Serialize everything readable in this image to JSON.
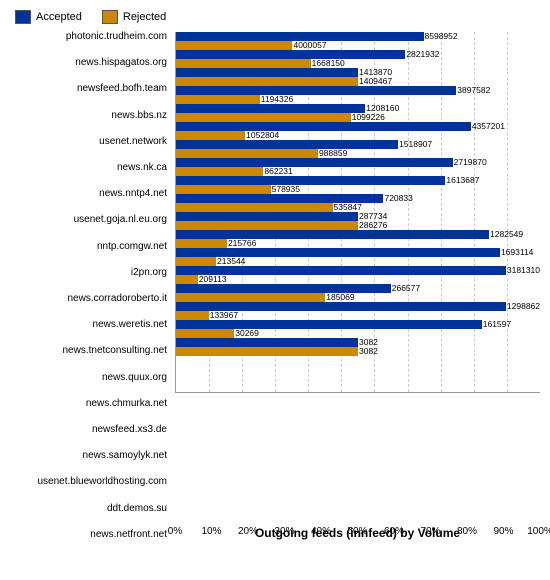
{
  "legend": {
    "accepted_label": "Accepted",
    "accepted_color": "#003399",
    "rejected_label": "Rejected",
    "rejected_color": "#cc8800"
  },
  "x_axis": {
    "ticks": [
      "0%",
      "10%",
      "20%",
      "30%",
      "40%",
      "50%",
      "60%",
      "70%",
      "80%",
      "90%",
      "100%"
    ],
    "title": "Outgoing feeds (innfeed) by Volume"
  },
  "rows": [
    {
      "label": "photonic.trudheim.com",
      "accepted": 8598952,
      "rejected": 4000057,
      "acc_pct": 68,
      "rej_pct": 32
    },
    {
      "label": "news.hispagatos.org",
      "accepted": 2821932,
      "rejected": 1668150,
      "acc_pct": 63,
      "rej_pct": 37
    },
    {
      "label": "newsfeed.bofh.team",
      "accepted": 1413870,
      "rejected": 1409467,
      "acc_pct": 50,
      "rej_pct": 50
    },
    {
      "label": "news.bbs.nz",
      "accepted": 3897582,
      "rejected": 1194326,
      "acc_pct": 77,
      "rej_pct": 23
    },
    {
      "label": "usenet.network",
      "accepted": 1208160,
      "rejected": 1099226,
      "acc_pct": 52,
      "rej_pct": 48
    },
    {
      "label": "news.nk.ca",
      "accepted": 4357201,
      "rejected": 1052804,
      "acc_pct": 81,
      "rej_pct": 19
    },
    {
      "label": "news.nntp4.net",
      "accepted": 1518907,
      "rejected": 988859,
      "acc_pct": 61,
      "rej_pct": 39
    },
    {
      "label": "usenet.goja.nl.eu.org",
      "accepted": 2719870,
      "rejected": 862231,
      "acc_pct": 76,
      "rej_pct": 24
    },
    {
      "label": "nntp.comgw.net",
      "accepted": 1613687,
      "rejected": 578935,
      "acc_pct": 74,
      "rej_pct": 26
    },
    {
      "label": "i2pn.org",
      "accepted": 720833,
      "rejected": 535847,
      "acc_pct": 57,
      "rej_pct": 43
    },
    {
      "label": "news.corradoroberto.it",
      "accepted": 287734,
      "rejected": 286276,
      "acc_pct": 50,
      "rej_pct": 50
    },
    {
      "label": "news.weretis.net",
      "accepted": 1282549,
      "rejected": 215766,
      "acc_pct": 86,
      "rej_pct": 14
    },
    {
      "label": "news.tnetconsulting.net",
      "accepted": 1693114,
      "rejected": 213544,
      "acc_pct": 89,
      "rej_pct": 11
    },
    {
      "label": "news.quux.org",
      "accepted": 3181310,
      "rejected": 209113,
      "acc_pct": 94,
      "rej_pct": 6
    },
    {
      "label": "news.chmurka.net",
      "accepted": 266577,
      "rejected": 185069,
      "acc_pct": 59,
      "rej_pct": 41
    },
    {
      "label": "newsfeed.xs3.de",
      "accepted": 1298862,
      "rejected": 133967,
      "acc_pct": 91,
      "rej_pct": 9
    },
    {
      "label": "news.samoylyk.net",
      "accepted": 161597,
      "rejected": 30269,
      "acc_pct": 84,
      "rej_pct": 16
    },
    {
      "label": "usenet.blueworldhosting.com",
      "accepted": 3082,
      "rejected": 3082,
      "acc_pct": 50,
      "rej_pct": 50
    },
    {
      "label": "ddt.demos.su",
      "accepted": 0,
      "rejected": 0,
      "acc_pct": 0,
      "rej_pct": 0
    },
    {
      "label": "news.netfront.net",
      "accepted": 0,
      "rejected": 0,
      "acc_pct": 0,
      "rej_pct": 0
    }
  ]
}
